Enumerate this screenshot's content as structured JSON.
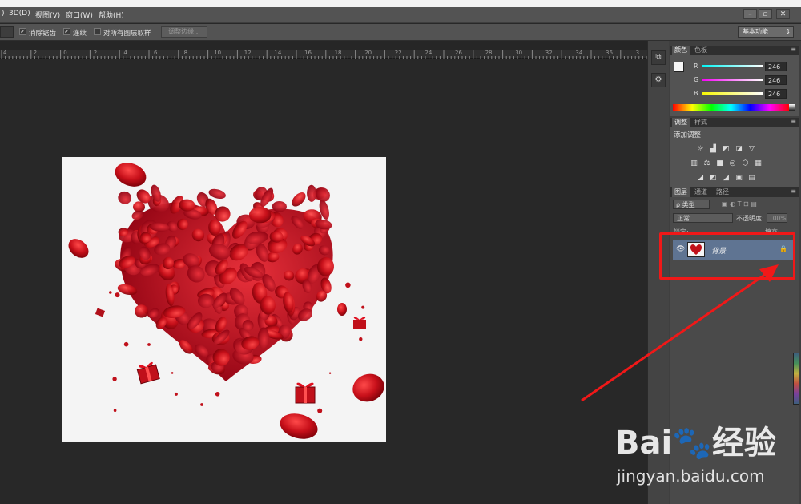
{
  "menu": {
    "items": [
      "3D(D)",
      "视图(V)",
      "窗口(W)",
      "帮助(H)"
    ],
    "window_buttons": [
      "–",
      "▫",
      "✕"
    ]
  },
  "options": {
    "antialias_label": "消除锯齿",
    "contiguous_label": "连续",
    "sample_all_label": "对所有图层取样",
    "refine_label": "调整边缘...",
    "workspace_label": "基本功能"
  },
  "ruler": {
    "ticks": [
      "4",
      "2",
      "0",
      "2",
      "4",
      "6",
      "8",
      "10",
      "12",
      "14",
      "16",
      "18",
      "20",
      "22",
      "24",
      "26",
      "28",
      "30",
      "32",
      "34",
      "36",
      "3"
    ]
  },
  "color_panel": {
    "tabs": [
      "颜色",
      "色板"
    ],
    "r_label": "R",
    "g_label": "G",
    "b_label": "B",
    "r_value": "246",
    "g_value": "246",
    "b_value": "246",
    "foreground_color": "#f6f6f6",
    "background_color": "#d49a18"
  },
  "adjustments_panel": {
    "tabs": [
      "调整",
      "样式"
    ],
    "heading": "添加调整"
  },
  "layers_panel": {
    "tabs": [
      "图层",
      "通道",
      "路径"
    ],
    "filter_label": "ρ 类型",
    "blend_mode": "正常",
    "opacity_label": "不透明度:",
    "opacity_value": "100%",
    "lock_label": "锁定:",
    "fill_label": "填充:",
    "layer_name": "背景"
  },
  "watermark": {
    "logo": "Bai🐾经验",
    "url": "jingyan.baidu.com"
  },
  "accent_colors": {
    "highlight": "#f01818",
    "selected_layer": "#5f7492"
  }
}
